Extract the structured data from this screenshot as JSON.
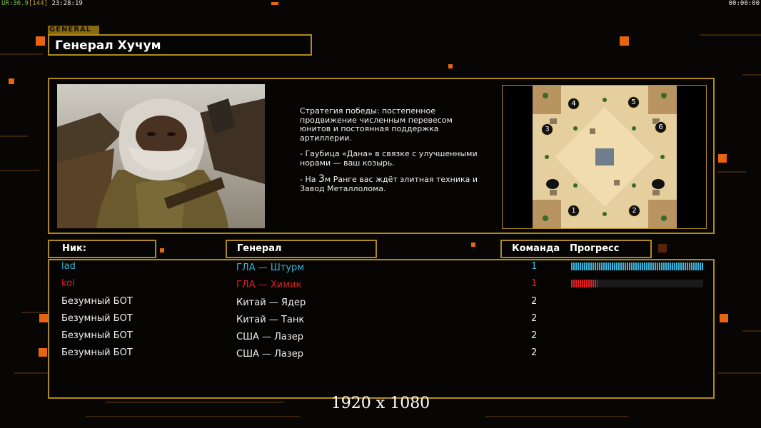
{
  "topbar": {
    "left_a": "UR:30.9",
    "left_b": "[144]",
    "left_c": "23:28:19",
    "right": "00:00:00"
  },
  "general": {
    "tag": "GENERAL",
    "name": "Генерал Хучум",
    "desc_p1": "Стратегия победы: постепенное продвижение численным перевесом юнитов и постоянная поддержка артиллерии.",
    "desc_p2": "- Гаубица «Дана» в связке с улучшенными норами — ваш козырь.",
    "desc_p3_a": "- На ",
    "desc_p3_num": "3",
    "desc_p3_b": "м Ранге вас ждёт элитная техника и Завод Металлолома."
  },
  "map": {
    "slots": [
      "4",
      "5",
      "3",
      "6",
      "1",
      "2"
    ]
  },
  "headers": {
    "nick": "Ник:",
    "general": "Генерал",
    "team": "Команда",
    "progress": "Прогресс"
  },
  "players": [
    {
      "nick": "lad",
      "general": "ГЛА — Штурм",
      "team": "1",
      "progress": 1.0,
      "color": "#3bb4dc"
    },
    {
      "nick": "koi",
      "general": "ГЛА — Химик",
      "team": "1",
      "progress": 0.2,
      "color": "#e02020"
    },
    {
      "nick": "Безумный БОТ",
      "general": "Китай — Ядер",
      "team": "2",
      "progress": null,
      "color": "#f0f0f0"
    },
    {
      "nick": "Безумный БОТ",
      "general": "Китай — Танк",
      "team": "2",
      "progress": null,
      "color": "#f0f0f0"
    },
    {
      "nick": "Безумный БОТ",
      "general": "США — Лазер",
      "team": "2",
      "progress": null,
      "color": "#f0f0f0"
    },
    {
      "nick": "Безумный БОТ",
      "general": "США — Лазер",
      "team": "2",
      "progress": null,
      "color": "#f0f0f0"
    }
  ],
  "resolution": "1920 x 1080"
}
